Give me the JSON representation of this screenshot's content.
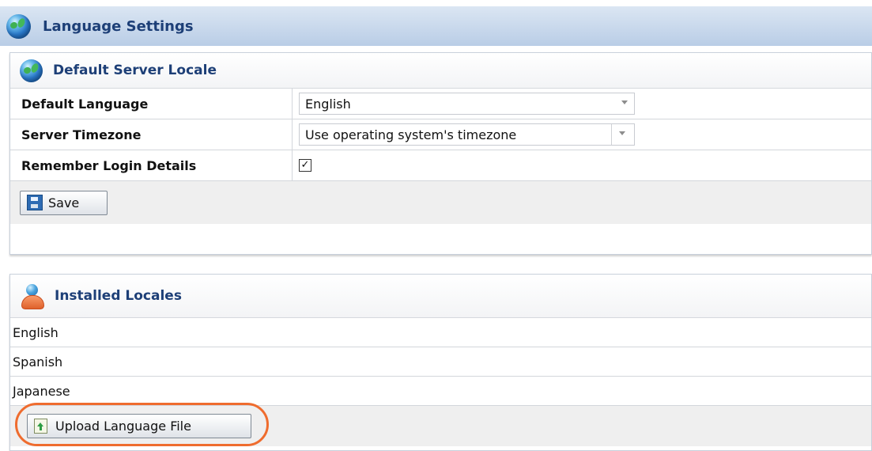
{
  "page": {
    "title": "Language Settings"
  },
  "default_server_locale": {
    "title": "Default Server Locale",
    "rows": [
      {
        "label": "Default Language",
        "value": "English"
      },
      {
        "label": "Server Timezone",
        "value": "Use operating system's timezone"
      },
      {
        "label": "Remember Login Details",
        "checked": true
      }
    ],
    "save_label": "Save"
  },
  "installed_locales": {
    "title": "Installed Locales",
    "items": [
      "English",
      "Spanish",
      "Japanese"
    ],
    "upload_label": "Upload Language File"
  },
  "icons": {
    "page_icon": "globe-icon",
    "section_icon": "globe-icon",
    "locales_icon": "user-icon",
    "save_icon": "floppy-disk-icon",
    "upload_icon": "upload-file-icon"
  },
  "colors": {
    "header_text": "#1d3f77",
    "highlight": "#ef6c2e"
  }
}
